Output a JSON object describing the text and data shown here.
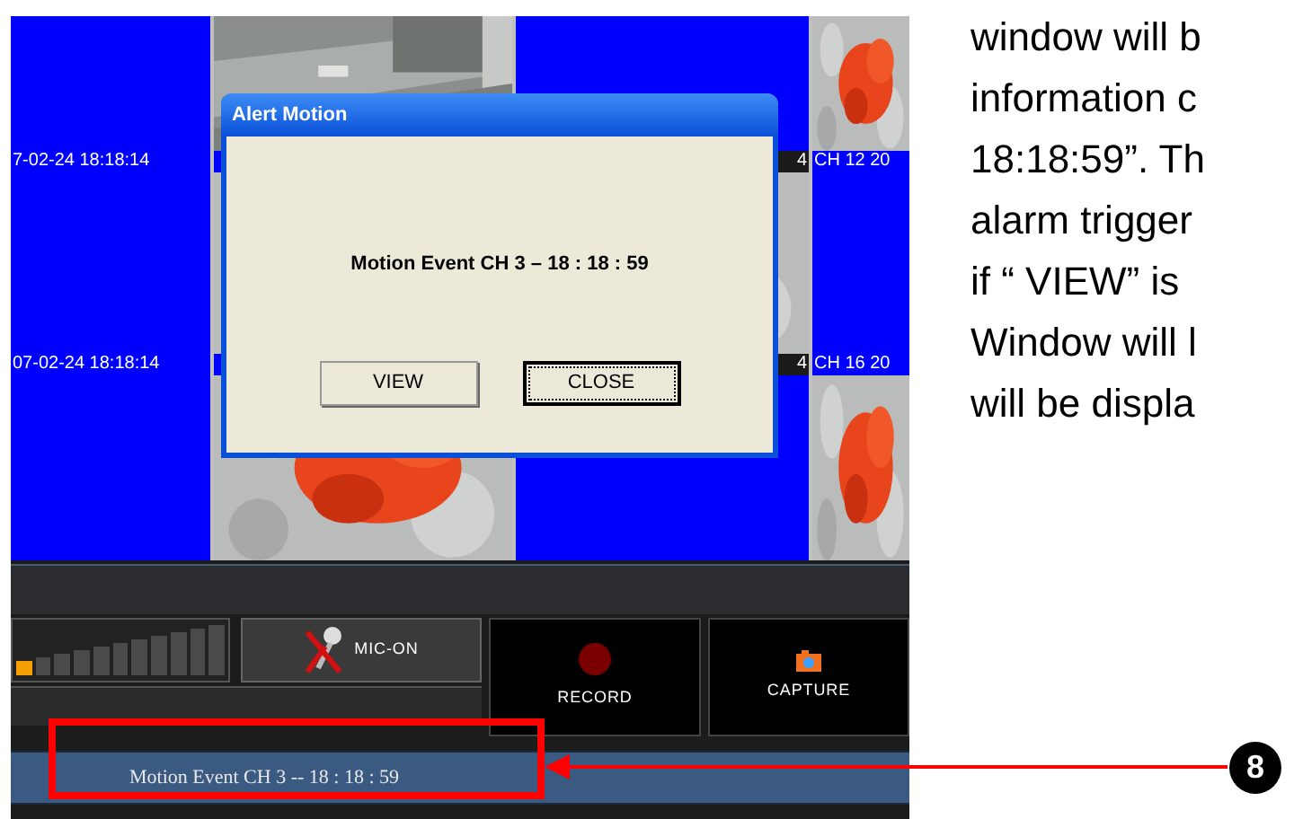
{
  "camera_grid": {
    "rows": [
      {
        "tiles": [
          {
            "kind": "blank",
            "caption": {
              "kind": "stamp",
              "text": "7-02-24 18:18:14"
            }
          },
          {
            "kind": "picture"
          },
          {
            "kind": "blank",
            "caption": {
              "kind": "tail",
              "text": "4"
            }
          },
          {
            "kind": "picture",
            "caption": {
              "kind": "stamp",
              "text": "CH 12 20"
            }
          }
        ]
      },
      {
        "tiles": [
          {
            "kind": "blank",
            "caption": {
              "kind": "stamp",
              "text": "07-02-24 18:18:14"
            }
          },
          {
            "kind": "picture"
          },
          {
            "kind": "picture",
            "caption": {
              "kind": "tail",
              "text": "4"
            }
          },
          {
            "kind": "blank",
            "caption": {
              "kind": "stamp",
              "text": "CH 16 20"
            }
          }
        ]
      },
      {
        "tiles": [
          {
            "kind": "blank"
          },
          {
            "kind": "picture"
          },
          {
            "kind": "blank"
          },
          {
            "kind": "picture"
          }
        ]
      }
    ]
  },
  "dialog": {
    "title": "Alert Motion",
    "message": "Motion Event CH 3 – 18 : 18 : 59",
    "buttons": [
      {
        "label": "VIEW",
        "focused": false
      },
      {
        "label": "CLOSE",
        "focused": true
      }
    ]
  },
  "controls": {
    "meter": {
      "level": 0.09
    },
    "mic": {
      "label": "MIC-ON",
      "muted": true
    },
    "record": {
      "label": "RECORD"
    },
    "capture": {
      "label": "CAPTURE"
    }
  },
  "status_bar": {
    "text": "Motion Event CH 3 -- 18 : 18 : 59"
  },
  "description": [
    "window will b",
    "information c",
    "18:18:59”. Th",
    "alarm trigger",
    "if “ VIEW” is",
    "Window will l",
    "will be displa"
  ],
  "callout": {
    "number": "8"
  }
}
